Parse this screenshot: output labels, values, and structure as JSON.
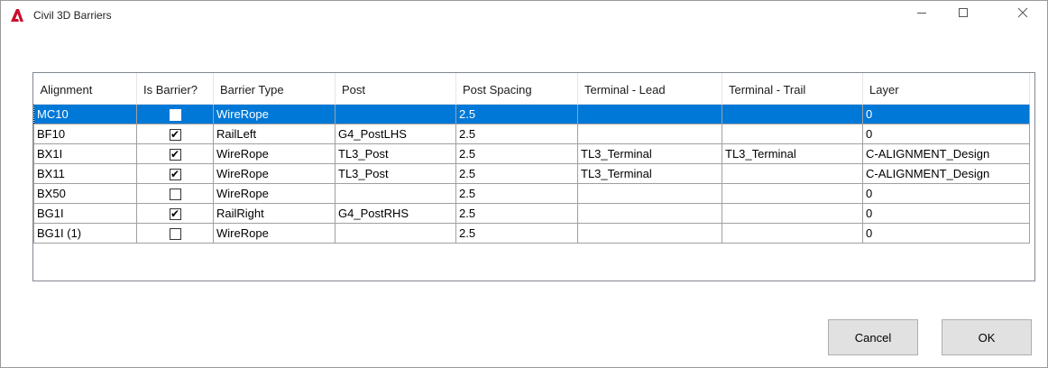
{
  "window": {
    "title": "Civil 3D Barriers",
    "app_icon": "autocad-a-icon",
    "controls": [
      "minimize-icon",
      "maximize-icon",
      "close-icon"
    ],
    "accent_color": "#0078d7",
    "icon_color": "#c8102e"
  },
  "grid": {
    "columns": [
      "Alignment",
      "Is Barrier?",
      "Barrier Type",
      "Post",
      "Post Spacing",
      "Terminal - Lead",
      "Terminal - Trail",
      "Layer"
    ],
    "rows": [
      {
        "alignment": "MC10",
        "is_barrier": false,
        "barrier_type": "WireRope",
        "post": "",
        "post_spacing": "2.5",
        "terminal_lead": "",
        "terminal_trail": "",
        "layer": "0",
        "selected": true
      },
      {
        "alignment": "BF10",
        "is_barrier": true,
        "barrier_type": "RailLeft",
        "post": "G4_PostLHS",
        "post_spacing": "2.5",
        "terminal_lead": "",
        "terminal_trail": "",
        "layer": "0",
        "selected": false
      },
      {
        "alignment": "BX1I",
        "is_barrier": true,
        "barrier_type": "WireRope",
        "post": "TL3_Post",
        "post_spacing": "2.5",
        "terminal_lead": "TL3_Terminal",
        "terminal_trail": "TL3_Terminal",
        "layer": "C-ALIGNMENT_Design",
        "selected": false
      },
      {
        "alignment": "BX11",
        "is_barrier": true,
        "barrier_type": "WireRope",
        "post": "TL3_Post",
        "post_spacing": "2.5",
        "terminal_lead": "TL3_Terminal",
        "terminal_trail": "",
        "layer": "C-ALIGNMENT_Design",
        "selected": false
      },
      {
        "alignment": "BX50",
        "is_barrier": false,
        "barrier_type": "WireRope",
        "post": "",
        "post_spacing": "2.5",
        "terminal_lead": "",
        "terminal_trail": "",
        "layer": "0",
        "selected": false
      },
      {
        "alignment": "BG1I",
        "is_barrier": true,
        "barrier_type": "RailRight",
        "post": "G4_PostRHS",
        "post_spacing": "2.5",
        "terminal_lead": "",
        "terminal_trail": "",
        "layer": "0",
        "selected": false
      },
      {
        "alignment": "BG1I (1)",
        "is_barrier": false,
        "barrier_type": "WireRope",
        "post": "",
        "post_spacing": "2.5",
        "terminal_lead": "",
        "terminal_trail": "",
        "layer": "0",
        "selected": false
      }
    ]
  },
  "buttons": {
    "cancel": "Cancel",
    "ok": "OK"
  }
}
